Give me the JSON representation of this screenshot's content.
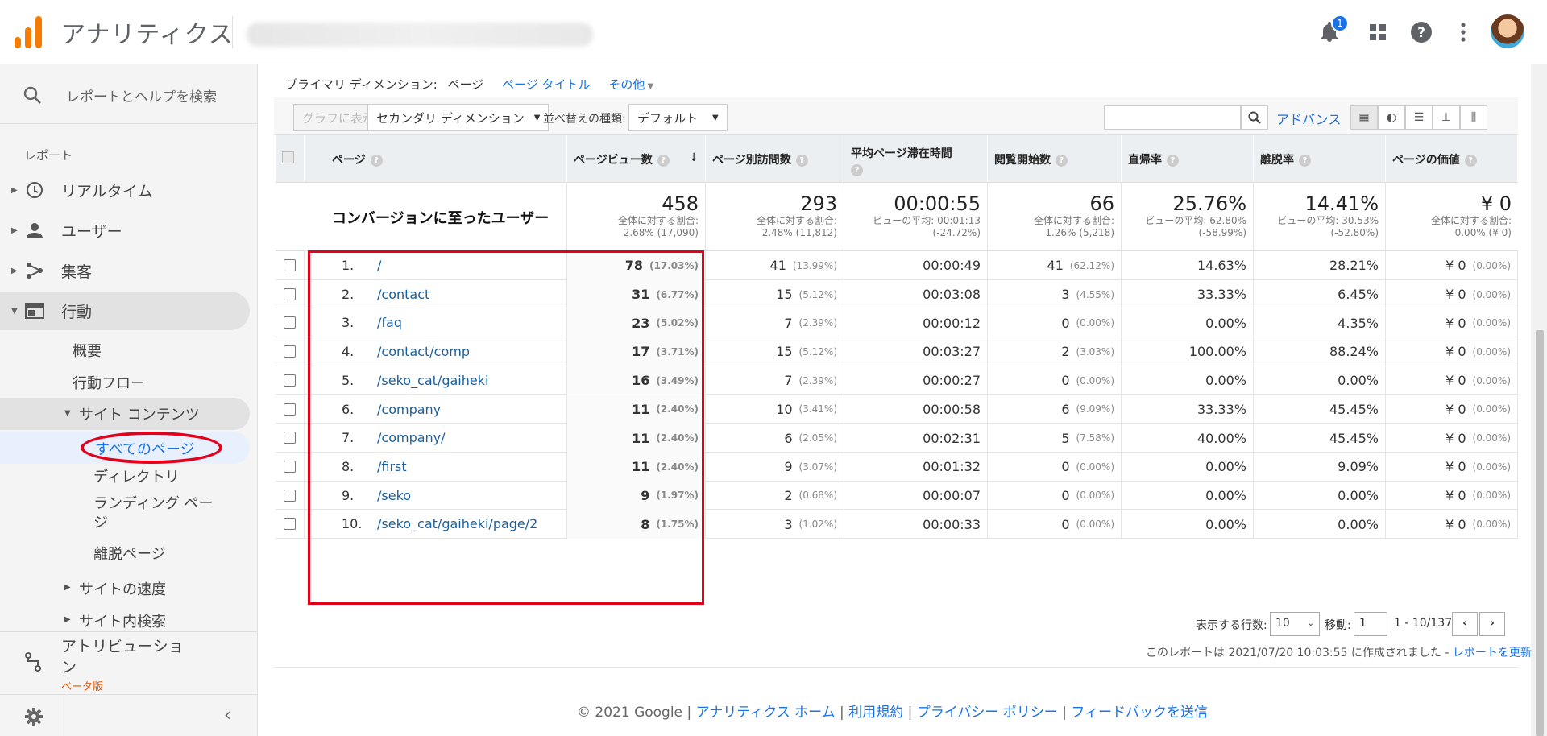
{
  "app": {
    "title": "アナリティクス"
  },
  "topbar": {
    "notification_count": "1",
    "icons": [
      "bell-icon",
      "apps-icon",
      "help-icon",
      "more-vert-icon",
      "avatar"
    ]
  },
  "sidebar": {
    "search_placeholder": "レポートとヘルプを検索",
    "section_label": "レポート",
    "items": [
      {
        "label": "リアルタイム",
        "icon": "clock-icon"
      },
      {
        "label": "ユーザー",
        "icon": "person-icon"
      },
      {
        "label": "集客",
        "icon": "acquisition-icon"
      },
      {
        "label": "行動",
        "icon": "behavior-icon"
      }
    ],
    "behavior_sub": [
      "概要",
      "行動フロー"
    ],
    "site_content": "サイト コンテンツ",
    "site_content_sub": [
      "すべてのページ",
      "ディレクトリ",
      "ランディング ペー\nジ",
      "離脱ページ"
    ],
    "site_speed": "サイトの速度",
    "site_search": "サイト内検索",
    "attribution": "アトリビューショ\nン",
    "beta": "ベータ版"
  },
  "dimension": {
    "label": "プライマリ ディメンション:",
    "current": "ページ",
    "alt1": "ページ タイトル",
    "alt2": "その他"
  },
  "toolbar": {
    "graph": "グラフに表示",
    "secondary": "セカンダリ ディメンション",
    "sort_label": "並べ替えの種類:",
    "sort_value": "デフォルト",
    "advanced": "アドバンス"
  },
  "table": {
    "headers": [
      "ページ",
      "ページビュー数",
      "ページ別訪問数",
      "平均ページ滞在時間",
      "閲覧開始数",
      "直帰率",
      "離脱率",
      "ページの価値"
    ],
    "segment": "コンバージョンに至ったユーザー",
    "summary": [
      {
        "big": "458",
        "l1": "全体に対する割合:",
        "l2": "2.68% (17,090)"
      },
      {
        "big": "293",
        "l1": "全体に対する割合:",
        "l2": "2.48% (11,812)"
      },
      {
        "big": "00:00:55",
        "l1": "ビューの平均: 00:01:13",
        "l2": "(-24.72%)"
      },
      {
        "big": "66",
        "l1": "全体に対する割合:",
        "l2": "1.26% (5,218)"
      },
      {
        "big": "25.76%",
        "l1": "ビューの平均: 62.80%",
        "l2": "(-58.99%)"
      },
      {
        "big": "14.41%",
        "l1": "ビューの平均: 30.53%",
        "l2": "(-52.80%)"
      },
      {
        "big": "¥ 0",
        "l1": "全体に対する割合:",
        "l2": "0.00% (¥ 0)"
      }
    ],
    "rows": [
      {
        "idx": "1.",
        "page": "/",
        "pv": "78",
        "pvp": "(17.03%)",
        "up": "41",
        "upp": "(13.99%)",
        "time": "00:00:49",
        "ent": "41",
        "entp": "(62.12%)",
        "bounce": "14.63%",
        "exit": "28.21%",
        "val": "¥ 0",
        "valp": "(0.00%)"
      },
      {
        "idx": "2.",
        "page": "/contact",
        "pv": "31",
        "pvp": "(6.77%)",
        "up": "15",
        "upp": "(5.12%)",
        "time": "00:03:08",
        "ent": "3",
        "entp": "(4.55%)",
        "bounce": "33.33%",
        "exit": "6.45%",
        "val": "¥ 0",
        "valp": "(0.00%)"
      },
      {
        "idx": "3.",
        "page": "/faq",
        "pv": "23",
        "pvp": "(5.02%)",
        "up": "7",
        "upp": "(2.39%)",
        "time": "00:00:12",
        "ent": "0",
        "entp": "(0.00%)",
        "bounce": "0.00%",
        "exit": "4.35%",
        "val": "¥ 0",
        "valp": "(0.00%)"
      },
      {
        "idx": "4.",
        "page": "/contact/comp",
        "pv": "17",
        "pvp": "(3.71%)",
        "up": "15",
        "upp": "(5.12%)",
        "time": "00:03:27",
        "ent": "2",
        "entp": "(3.03%)",
        "bounce": "100.00%",
        "exit": "88.24%",
        "val": "¥ 0",
        "valp": "(0.00%)"
      },
      {
        "idx": "5.",
        "page": "/seko_cat/gaiheki",
        "pv": "16",
        "pvp": "(3.49%)",
        "up": "7",
        "upp": "(2.39%)",
        "time": "00:00:27",
        "ent": "0",
        "entp": "(0.00%)",
        "bounce": "0.00%",
        "exit": "0.00%",
        "val": "¥ 0",
        "valp": "(0.00%)"
      },
      {
        "idx": "6.",
        "page": "/company",
        "pv": "11",
        "pvp": "(2.40%)",
        "up": "10",
        "upp": "(3.41%)",
        "time": "00:00:58",
        "ent": "6",
        "entp": "(9.09%)",
        "bounce": "33.33%",
        "exit": "45.45%",
        "val": "¥ 0",
        "valp": "(0.00%)"
      },
      {
        "idx": "7.",
        "page": "/company/",
        "pv": "11",
        "pvp": "(2.40%)",
        "up": "6",
        "upp": "(2.05%)",
        "time": "00:02:31",
        "ent": "5",
        "entp": "(7.58%)",
        "bounce": "40.00%",
        "exit": "45.45%",
        "val": "¥ 0",
        "valp": "(0.00%)"
      },
      {
        "idx": "8.",
        "page": "/first",
        "pv": "11",
        "pvp": "(2.40%)",
        "up": "9",
        "upp": "(3.07%)",
        "time": "00:01:32",
        "ent": "0",
        "entp": "(0.00%)",
        "bounce": "0.00%",
        "exit": "9.09%",
        "val": "¥ 0",
        "valp": "(0.00%)"
      },
      {
        "idx": "9.",
        "page": "/seko",
        "pv": "9",
        "pvp": "(1.97%)",
        "up": "2",
        "upp": "(0.68%)",
        "time": "00:00:07",
        "ent": "0",
        "entp": "(0.00%)",
        "bounce": "0.00%",
        "exit": "0.00%",
        "val": "¥ 0",
        "valp": "(0.00%)"
      },
      {
        "idx": "10.",
        "page": "/seko_cat/gaiheki/page/2",
        "pv": "8",
        "pvp": "(1.75%)",
        "up": "3",
        "upp": "(1.02%)",
        "time": "00:00:33",
        "ent": "0",
        "entp": "(0.00%)",
        "bounce": "0.00%",
        "exit": "0.00%",
        "val": "¥ 0",
        "valp": "(0.00%)"
      }
    ]
  },
  "pager": {
    "rows_label": "表示する行数:",
    "rows_value": "10",
    "goto_label": "移動:",
    "goto_value": "1",
    "range": "1 - 10/137"
  },
  "report_note": {
    "text": "このレポートは 2021/07/20 10:03:55 に作成されました - ",
    "link": "レポートを更新"
  },
  "footer": {
    "copyright": "© 2021 Google",
    "links": [
      "アナリティクス ホーム",
      "利用規約",
      "プライバシー ポリシー",
      "フィードバックを送信"
    ]
  },
  "colors": {
    "accent": "#1a73e8",
    "highlight": "#e2001a",
    "logo": "#f57c00"
  }
}
